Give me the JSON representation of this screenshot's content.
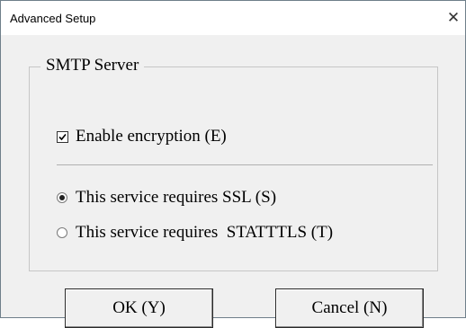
{
  "window": {
    "title": "Advanced Setup",
    "close_glyph": "✕"
  },
  "group": {
    "legend": "SMTP Server",
    "encryption_checkbox": {
      "label": "Enable encryption (E)",
      "checked": true
    },
    "security_options": [
      {
        "label": "This service requires SSL (S)",
        "selected": true
      },
      {
        "label": "This service requires  STATTTLS (T)",
        "selected": false
      }
    ]
  },
  "buttons": {
    "ok_label": "OK (Y)",
    "cancel_label": "Cancel (N)"
  }
}
